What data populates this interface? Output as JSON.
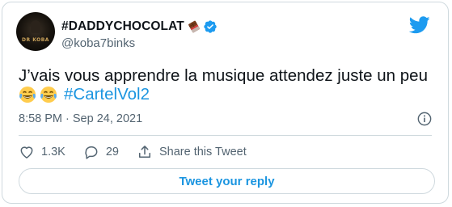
{
  "tweet": {
    "display_name": "#DADDYCHOCOLAT",
    "handle": "@koba7binks",
    "text_line1": "J’vais vous apprendre la musique attendez juste un peu",
    "emojis": [
      "face-with-tears-of-joy",
      "face-with-tears-of-joy"
    ],
    "hashtag": "#CartelVol2",
    "timestamp": "8:58 PM · Sep 24, 2021",
    "avatar_label": "DR KOBA"
  },
  "actions": {
    "likes": "1.3K",
    "replies": "29",
    "share_label": "Share this Tweet"
  },
  "reply_button_label": "Tweet your reply",
  "colors": {
    "link": "#1b95e0",
    "twitter_blue": "#1d9bf0",
    "secondary_text": "#536471",
    "border": "#cfd9de"
  },
  "icons": [
    "chocolate-bar-icon",
    "verified-badge-icon",
    "twitter-bird-icon",
    "info-icon",
    "heart-icon",
    "reply-bubble-icon",
    "share-icon"
  ]
}
